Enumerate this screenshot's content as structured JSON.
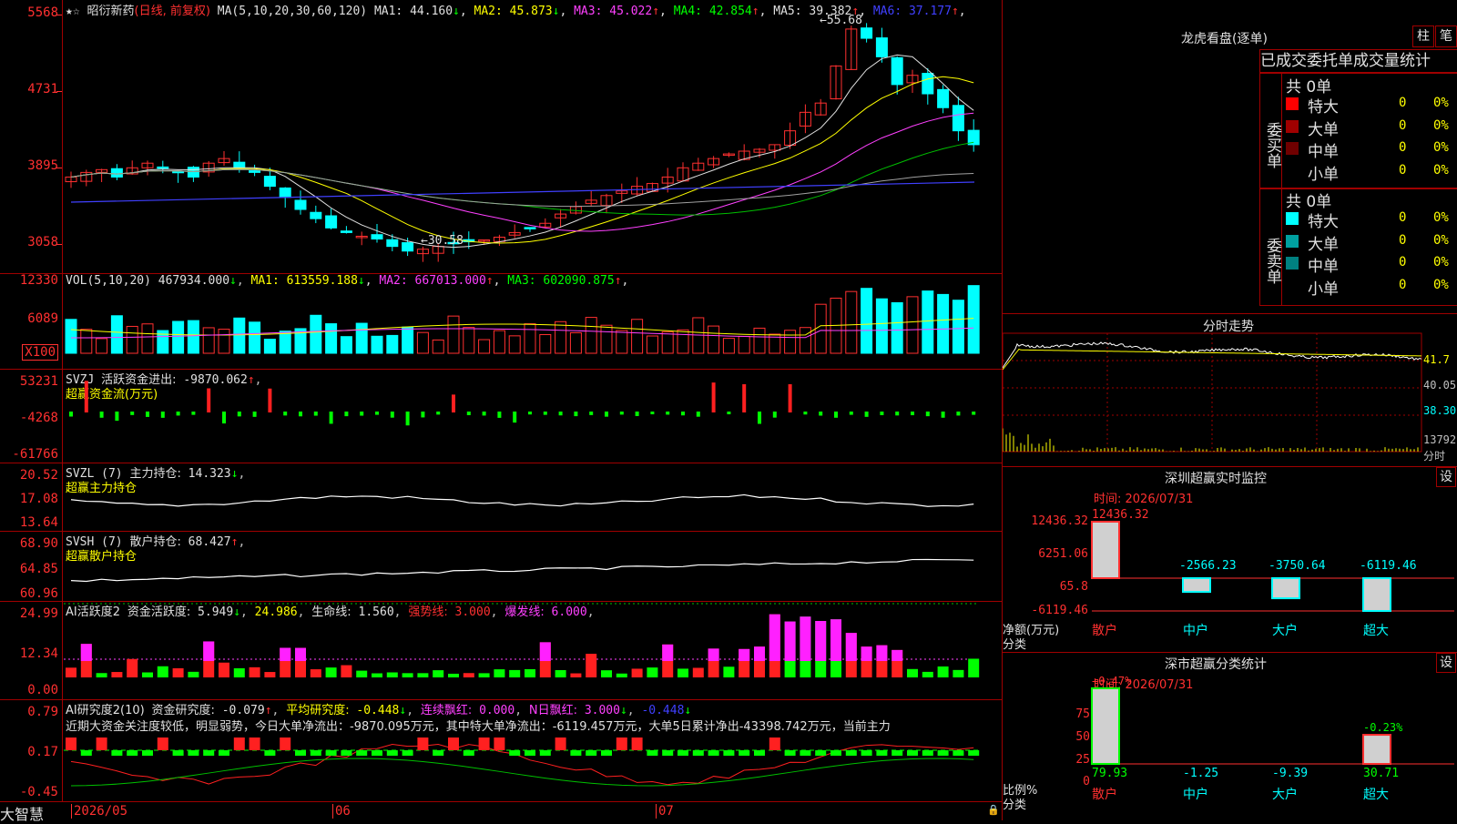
{
  "stock": {
    "name": "昭衍新药",
    "period": "(日线, 前复权)"
  },
  "price_panel": {
    "ma_label": "MA(5,10,20,30,60,120)",
    "ma": [
      {
        "name": "MA1",
        "value": "44.160",
        "dir": "↓",
        "color": "#e0e0e0"
      },
      {
        "name": "MA2",
        "value": "45.873",
        "dir": "↓",
        "color": "#ffff00"
      },
      {
        "name": "MA3",
        "value": "45.022",
        "dir": "↑",
        "color": "#ff40ff"
      },
      {
        "name": "MA4",
        "value": "42.854",
        "dir": "↑",
        "color": "#00ff00"
      },
      {
        "name": "MA5",
        "value": "39.382",
        "dir": "↑",
        "color": "#e0e0e0"
      },
      {
        "name": "MA6",
        "value": "37.177",
        "dir": "↑",
        "color": "#4040ff"
      }
    ],
    "ticks": [
      "5568",
      "4731",
      "3895",
      "3058"
    ],
    "high_label": "55.68",
    "low_label": "30.58"
  },
  "vol_panel": {
    "label": "VOL(5,10,20)",
    "value": "467934.000",
    "dir": "↓",
    "ma": [
      {
        "name": "MA1",
        "value": "613559.188",
        "dir": "↓",
        "color": "#ffff00"
      },
      {
        "name": "MA2",
        "value": "667013.000",
        "dir": "↑",
        "color": "#ff40ff"
      },
      {
        "name": "MA3",
        "value": "602090.875",
        "dir": "↑",
        "color": "#00ff00"
      }
    ],
    "ticks": [
      "12330",
      "6089"
    ],
    "unit": "X100"
  },
  "svzj_panel": {
    "label": "SVZJ",
    "title": "活跃资金进出:",
    "value": "-9870.062",
    "dir": "↑",
    "sub": "超赢资金流(万元)",
    "ticks": [
      "53231",
      "-4268",
      "-61766"
    ]
  },
  "svzl_panel": {
    "label": "SVZL (7)",
    "title": "主力持仓:",
    "value": "14.323",
    "dir": "↓",
    "sub": "超赢主力持仓",
    "ticks": [
      "20.52",
      "17.08",
      "13.64"
    ]
  },
  "svsh_panel": {
    "label": "SVSH (7)",
    "title": "散户持仓:",
    "value": "68.427",
    "dir": "↑",
    "sub": "超赢散户持仓",
    "ticks": [
      "68.90",
      "64.85",
      "60.96"
    ]
  },
  "ai1_panel": {
    "label": "AI活跃度2",
    "title": "资金活跃度:",
    "value": "5.949",
    "dir": "↓",
    "v2": "24.986",
    "life_label": "生命线:",
    "life": "1.560",
    "strong_label": "强势线:",
    "strong": "3.000",
    "burst_label": "爆发线:",
    "burst": "6.000",
    "ticks": [
      "24.99",
      "12.34",
      "0.00"
    ]
  },
  "ai2_panel": {
    "label": "AI研究度2(10)",
    "title": "资金研究度:",
    "value": "-0.079",
    "dir": "↑",
    "avg_label": "平均研究度:",
    "avg": "-0.448",
    "avg_dir": "↓",
    "red_label": "连续飘红:",
    "red": "0.000",
    "n_label": "N日飘红:",
    "n": "3.000",
    "n_dir": "↓",
    "last": "-0.448",
    "last_dir": "↓",
    "comment": "近期大资金关注度较低，明显弱势，今日大单净流出：-9870.095万元，其中特大单净流出：-6119.457万元，大单5日累计净出-43398.742万元，当前主力",
    "ticks": [
      "0.79",
      "0.17",
      "-0.45"
    ]
  },
  "bottom_axis": {
    "brand": "大智慧",
    "dates": [
      "2026/05",
      "06",
      "07"
    ]
  },
  "dragon": {
    "title": "龙虎看盘(逐单)",
    "tabs": [
      "柱",
      "笔"
    ],
    "stat_title": "已成交委托单成交量统计",
    "buy": {
      "label": "委买单",
      "count": "共 0单",
      "rows": [
        {
          "name": "特大",
          "n": "0",
          "pct": "0%",
          "color": "#ff0000"
        },
        {
          "name": "大单",
          "n": "0",
          "pct": "0%",
          "color": "#a00000"
        },
        {
          "name": "中单",
          "n": "0",
          "pct": "0%",
          "color": "#700000"
        },
        {
          "name": "小单",
          "n": "0",
          "pct": "0%",
          "color": "#000000"
        }
      ]
    },
    "sell": {
      "label": "委卖单",
      "count": "共 0单",
      "rows": [
        {
          "name": "特大",
          "n": "0",
          "pct": "0%",
          "color": "#00ffff"
        },
        {
          "name": "大单",
          "n": "0",
          "pct": "0%",
          "color": "#00a0a0"
        },
        {
          "name": "中单",
          "n": "0",
          "pct": "0%",
          "color": "#008080"
        },
        {
          "name": "小单",
          "n": "0",
          "pct": "0%",
          "color": "#000000"
        }
      ]
    }
  },
  "intraday": {
    "title": "分时走势",
    "ticks": [
      "41.7",
      "40.05",
      "38.30"
    ],
    "vol": "13792",
    "vol_unit": "分时"
  },
  "monitor": {
    "title": "深圳超赢实时监控",
    "setting": "设",
    "time": "时间: 2026/07/31",
    "ticks": [
      "12436.32",
      "6251.06",
      "65.8",
      "-6119.46"
    ],
    "ylabel": "净额(万元)",
    "xlabel": "分类",
    "chart_data": {
      "type": "bar",
      "categories": [
        "散户",
        "中户",
        "大户",
        "超大"
      ],
      "values": [
        12436.32,
        -2566.23,
        -3750.64,
        -6119.46
      ],
      "ylim": [
        -6119.46,
        12436.32
      ]
    }
  },
  "classify": {
    "title": "深市超赢分类统计",
    "setting": "设",
    "time": "时间: 2026/07/31",
    "ticks": [
      "75",
      "50",
      "25",
      "0"
    ],
    "ylabel": "比例%",
    "xlabel": "分类",
    "chart_data": {
      "type": "bar",
      "categories": [
        "散户",
        "中户",
        "大户",
        "超大"
      ],
      "values": [
        79.93,
        -1.25,
        -9.39,
        30.71
      ],
      "top": [
        "+0.47%",
        "",
        "",
        "-0.23%"
      ],
      "ylim": [
        0,
        75
      ]
    }
  }
}
